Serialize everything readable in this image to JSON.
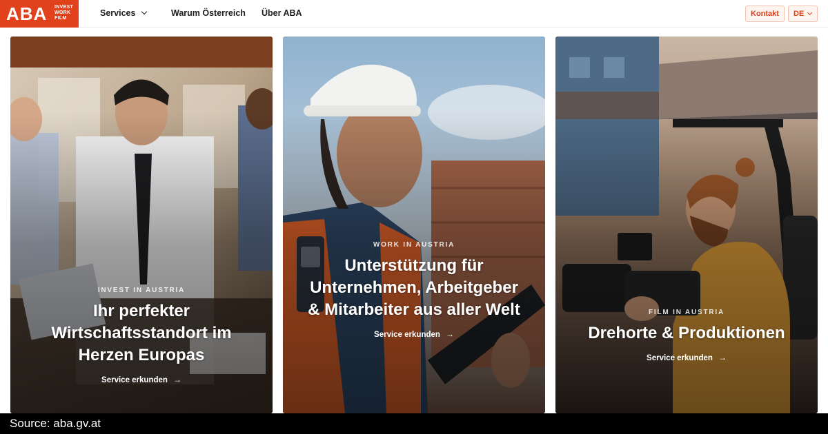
{
  "header": {
    "logo": {
      "mark": "ABA",
      "words": [
        "INVEST",
        "WORK",
        "FILM"
      ]
    },
    "nav": {
      "services": "Services",
      "warum": "Warum Österreich",
      "uber": "Über ABA"
    },
    "kontakt": "Kontakt",
    "language": "DE"
  },
  "cards": [
    {
      "eyebrow": "INVEST IN AUSTRIA",
      "headline": "Ihr perfekter Wirtschaftsstandort im Herzen Europas",
      "cta": "Service erkunden",
      "arrow": "→"
    },
    {
      "eyebrow": "WORK IN AUSTRIA",
      "headline": "Unterstützung für Unternehmen, Arbeitgeber & Mitarbeiter aus aller Welt",
      "cta": "Service erkunden",
      "arrow": "→"
    },
    {
      "eyebrow": "FILM IN AUSTRIA",
      "headline": "Drehorte & Produktionen",
      "cta": "Service erkunden",
      "arrow": "→"
    }
  ],
  "source": "Source:  aba.gv.at",
  "colors": {
    "brand": "#e2421b",
    "button_bg": "#fdf3ef",
    "button_text": "#d9421c"
  }
}
